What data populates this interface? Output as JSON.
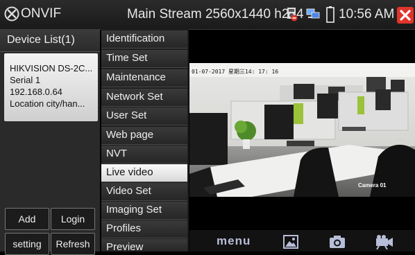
{
  "titlebar": {
    "brand": "ONVIF",
    "stream_title": "Main Stream 2560x1440 h264",
    "clock": "10:56 AM",
    "icons": [
      "onvif-logo-icon",
      "speaker-muted-icon",
      "network-icon",
      "battery-icon",
      "close-icon"
    ],
    "close_color": "#e0352b"
  },
  "device_panel": {
    "header": "Device List(1)",
    "device": {
      "name": "HIKVISION DS-2C...",
      "serial": "Serial 1",
      "ip": "192.168.0.64",
      "location": "Location city/han..."
    },
    "buttons": {
      "add": "Add",
      "login": "Login",
      "setting": "setting",
      "refresh": "Refresh"
    }
  },
  "menu": {
    "items": [
      {
        "label": "Identification"
      },
      {
        "label": "Time Set"
      },
      {
        "label": "Maintenance"
      },
      {
        "label": "Network Set"
      },
      {
        "label": "User Set"
      },
      {
        "label": "Web page"
      },
      {
        "label": "NVT"
      },
      {
        "label": "Live video",
        "active": true
      },
      {
        "label": "Video Set"
      },
      {
        "label": "Imaging Set"
      },
      {
        "label": "Profiles"
      },
      {
        "label": "Preview"
      }
    ]
  },
  "video": {
    "osd_date": "01-07-2017 星期三14: 17: 16",
    "osd_camera": "Camera 01"
  },
  "toolbar": {
    "menu_label": "menu",
    "icons": [
      "gallery-icon",
      "camera-icon",
      "video-record-icon"
    ],
    "icon_color": "#b8bed8"
  }
}
